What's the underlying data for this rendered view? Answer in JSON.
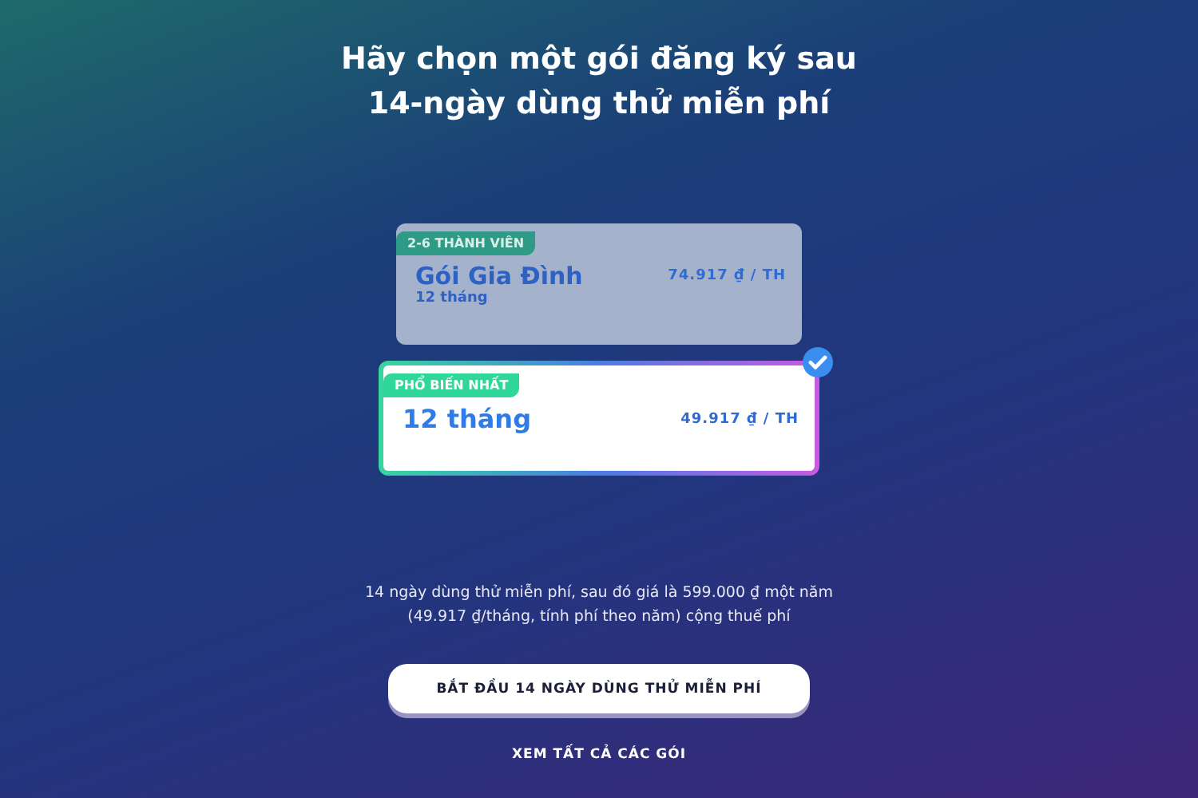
{
  "heading": [
    "Hãy chọn một gói đăng ký sau",
    "14-ngày dùng thử miễn phí"
  ],
  "plans": [
    {
      "badge": "2-6 THÀNH VIÊN",
      "name": "Gói Gia Đình",
      "term": "12 tháng",
      "price": "74.917 ₫ / TH",
      "selected": false
    },
    {
      "badge": "PHỔ BIẾN NHẤT",
      "name": "12 tháng",
      "price": "49.917 ₫ / TH",
      "selected": true
    }
  ],
  "note": [
    "14 ngày dùng thử miễn phí, sau đó giá là 599.000 ₫ một năm",
    "(49.917 ₫/tháng, tính phí theo năm) cộng thuế phí"
  ],
  "primary_button": "BẮT ĐẦU 14 NGÀY DÙNG THỬ MIỄN PHÍ",
  "secondary_link": "XEM TẤT CẢ CÁC GÓI"
}
